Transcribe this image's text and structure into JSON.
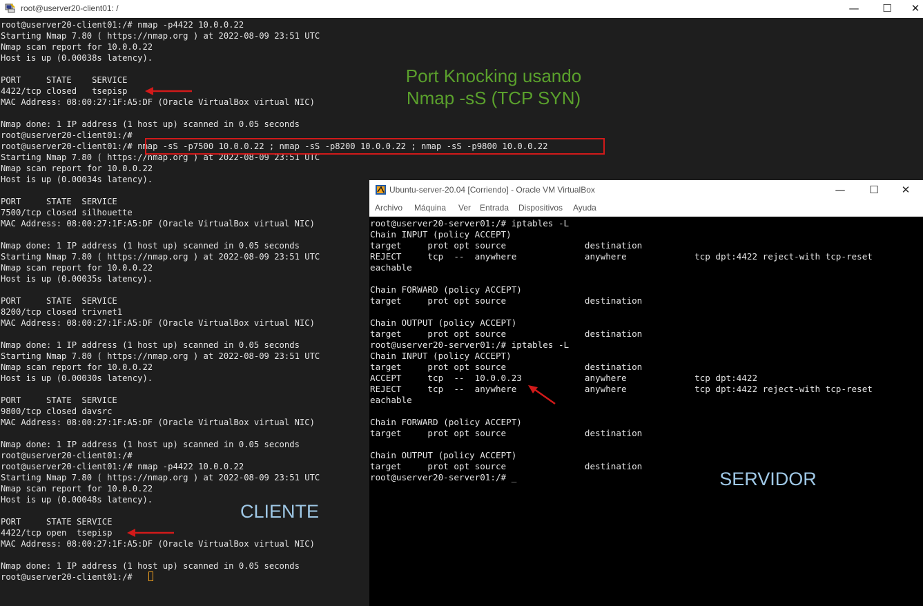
{
  "colors": {
    "terminal_bg": "#1e1e1e",
    "terminal_text": "#e6e6e6",
    "server_bg": "#000000",
    "note_green": "#5aa02c",
    "note_blue": "#9fc8e6",
    "arrow_red": "#d21a1a",
    "cursor_orange": "#f0a020"
  },
  "client_window": {
    "title": "root@userver20-client01: /",
    "icon": "putty-icon",
    "lines": [
      "root@userver20-client01:/# nmap -p4422 10.0.0.22",
      "Starting Nmap 7.80 ( https://nmap.org ) at 2022-08-09 23:51 UTC",
      "Nmap scan report for 10.0.0.22",
      "Host is up (0.00038s latency).",
      "",
      "PORT     STATE    SERVICE",
      "4422/tcp closed   tsepisp",
      "MAC Address: 08:00:27:1F:A5:DF (Oracle VirtualBox virtual NIC)",
      "",
      "Nmap done: 1 IP address (1 host up) scanned in 0.05 seconds",
      "root@userver20-client01:/#",
      "root@userver20-client01:/# nmap -sS -p7500 10.0.0.22 ; nmap -sS -p8200 10.0.0.22 ; nmap -sS -p9800 10.0.0.22",
      "Starting Nmap 7.80 ( https://nmap.org ) at 2022-08-09 23:51 UTC",
      "Nmap scan report for 10.0.0.22",
      "Host is up (0.00034s latency).",
      "",
      "PORT     STATE  SERVICE",
      "7500/tcp closed silhouette",
      "MAC Address: 08:00:27:1F:A5:DF (Oracle VirtualBox virtual NIC)",
      "",
      "Nmap done: 1 IP address (1 host up) scanned in 0.05 seconds",
      "Starting Nmap 7.80 ( https://nmap.org ) at 2022-08-09 23:51 UTC",
      "Nmap scan report for 10.0.0.22",
      "Host is up (0.00035s latency).",
      "",
      "PORT     STATE  SERVICE",
      "8200/tcp closed trivnet1",
      "MAC Address: 08:00:27:1F:A5:DF (Oracle VirtualBox virtual NIC)",
      "",
      "Nmap done: 1 IP address (1 host up) scanned in 0.05 seconds",
      "Starting Nmap 7.80 ( https://nmap.org ) at 2022-08-09 23:51 UTC",
      "Nmap scan report for 10.0.0.22",
      "Host is up (0.00030s latency).",
      "",
      "PORT     STATE  SERVICE",
      "9800/tcp closed davsrc",
      "MAC Address: 08:00:27:1F:A5:DF (Oracle VirtualBox virtual NIC)",
      "",
      "Nmap done: 1 IP address (1 host up) scanned in 0.05 seconds",
      "root@userver20-client01:/#",
      "root@userver20-client01:/# nmap -p4422 10.0.0.22",
      "Starting Nmap 7.80 ( https://nmap.org ) at 2022-08-09 23:51 UTC",
      "Nmap scan report for 10.0.0.22",
      "Host is up (0.00048s latency).",
      "",
      "PORT     STATE SERVICE",
      "4422/tcp open  tsepisp",
      "MAC Address: 08:00:27:1F:A5:DF (Oracle VirtualBox virtual NIC)",
      "",
      "Nmap done: 1 IP address (1 host up) scanned in 0.05 seconds",
      "root@userver20-client01:/# "
    ]
  },
  "server_window": {
    "title": "Ubuntu-server-20.04 [Corriendo] - Oracle VM VirtualBox",
    "icon": "virtualbox-icon",
    "menu": [
      "Archivo",
      "Máquina",
      "Ver",
      "Entrada",
      "Dispositivos",
      "Ayuda"
    ],
    "lines": [
      "root@userver20-server01:/# iptables -L",
      "Chain INPUT (policy ACCEPT)",
      "target     prot opt source               destination",
      "REJECT     tcp  --  anywhere             anywhere             tcp dpt:4422 reject-with tcp-reset",
      "eachable",
      "",
      "Chain FORWARD (policy ACCEPT)",
      "target     prot opt source               destination",
      "",
      "Chain OUTPUT (policy ACCEPT)",
      "target     prot opt source               destination",
      "root@userver20-server01:/# iptables -L",
      "Chain INPUT (policy ACCEPT)",
      "target     prot opt source               destination",
      "ACCEPT     tcp  --  10.0.0.23            anywhere             tcp dpt:4422",
      "REJECT     tcp  --  anywhere             anywhere             tcp dpt:4422 reject-with tcp-reset",
      "eachable",
      "",
      "Chain FORWARD (policy ACCEPT)",
      "target     prot opt source               destination",
      "",
      "Chain OUTPUT (policy ACCEPT)",
      "target     prot opt source               destination",
      "root@userver20-server01:/# _"
    ]
  },
  "annotations": {
    "heading_line1": "Port Knocking usando",
    "heading_line2": "Nmap -sS (TCP SYN)",
    "cliente": "CLIENTE",
    "servidor": "SERVIDOR"
  },
  "window_controls": {
    "minimize": "—",
    "maximize": "☐",
    "close": "✕"
  }
}
